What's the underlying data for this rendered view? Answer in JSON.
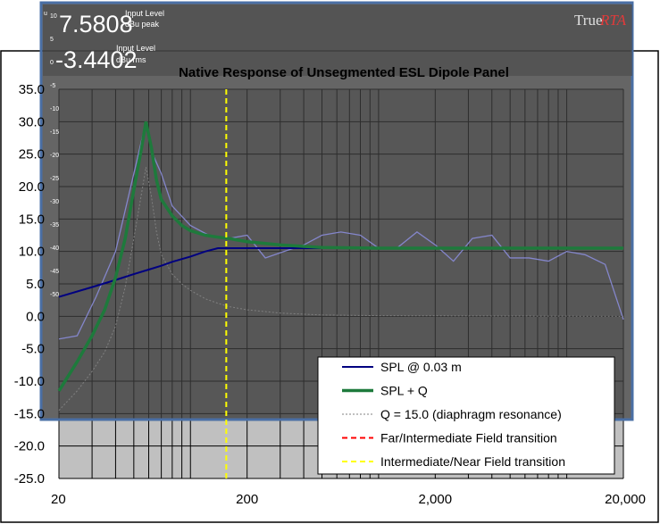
{
  "overlay": {
    "input_level_peak": "7.5808",
    "input_level_peak_label": "Input Level",
    "input_level_peak_unit": "dBu peak",
    "input_level_rms": "-3.4402",
    "input_level_rms_label": "Input Level",
    "input_level_rms_unit": "dBu rms",
    "brand_true": "True",
    "brand_rta": "RTA",
    "left_scale": [
      "10",
      "5",
      "0",
      "-5",
      "-10",
      "-15",
      "-20",
      "-25",
      "-30",
      "-35",
      "-40",
      "-45",
      "-50"
    ],
    "left_scale_unit": "u"
  },
  "chart_data": {
    "type": "line",
    "title": "Native Response of Unsegmented ESL Dipole Panel",
    "x_scale": "log",
    "xlim": [
      20,
      20000
    ],
    "ylim": [
      -25,
      35
    ],
    "x_ticks": [
      20,
      200,
      2000,
      20000
    ],
    "x_tick_labels": [
      "20",
      "200",
      "2,000",
      "20,000"
    ],
    "y_ticks": [
      35,
      30,
      25,
      20,
      15,
      10,
      5,
      0,
      -5,
      -10,
      -15,
      -20,
      -25
    ],
    "y_tick_labels": [
      "35.0",
      "30.0",
      "25.0",
      "20.0",
      "15.0",
      "10.0",
      "5.0",
      "0.0",
      "-5.0",
      "-10.0",
      "-15.0",
      "-20.0",
      "-25.0"
    ],
    "grid": true,
    "legend_position": "bottom-right",
    "vertical_markers": [
      {
        "name": "Intermediate/Near Field transition",
        "x": 155,
        "color": "#ffff00",
        "style": "dashed"
      }
    ],
    "series": [
      {
        "name": "SPL @ 0.03 m",
        "color": "#000080",
        "width": 2,
        "style": "solid",
        "x": [
          20,
          30,
          40,
          50,
          60,
          70,
          80,
          100,
          120,
          140,
          155,
          160,
          200,
          300,
          500,
          1000,
          20000
        ],
        "y": [
          3.0,
          4.5,
          5.6,
          6.5,
          7.2,
          7.8,
          8.4,
          9.2,
          10.0,
          10.5,
          10.5,
          10.5,
          10.5,
          10.5,
          10.5,
          10.5,
          10.5
        ]
      },
      {
        "name": "SPL + Q",
        "color": "#1e7a3c",
        "width": 3.5,
        "style": "solid",
        "x": [
          20,
          25,
          30,
          35,
          40,
          45,
          50,
          55,
          58,
          62,
          66,
          70,
          80,
          90,
          100,
          120,
          140,
          160,
          200,
          300,
          500,
          1000,
          20000
        ],
        "y": [
          -11.5,
          -7.0,
          -3.0,
          1.0,
          6.0,
          12.0,
          19.5,
          26.0,
          30.0,
          26.0,
          21.0,
          18.0,
          15.5,
          14.0,
          13.2,
          12.5,
          12.2,
          12.0,
          11.5,
          11.0,
          10.6,
          10.5,
          10.5
        ]
      },
      {
        "name": "Q = 15.0 (diaphragm resonance)",
        "color": "#808080",
        "width": 1,
        "style": "dotted",
        "x": [
          20,
          25,
          30,
          35,
          40,
          45,
          50,
          55,
          58,
          62,
          66,
          70,
          80,
          90,
          100,
          120,
          140,
          160,
          200,
          300,
          500,
          1000,
          20000
        ],
        "y": [
          -14.5,
          -11.5,
          -8.5,
          -5.5,
          -1.5,
          4.5,
          12.0,
          19.0,
          23.0,
          18.5,
          13.0,
          9.5,
          6.5,
          5.0,
          4.0,
          2.7,
          2.0,
          1.5,
          1.0,
          0.5,
          0.2,
          0.1,
          0.0
        ]
      },
      {
        "name": "Far/Intermediate Field transition",
        "color": "#ff0000",
        "style": "dashed",
        "x": [],
        "y": []
      },
      {
        "name": "Intermediate/Near Field transition",
        "color": "#ffff00",
        "style": "dashed",
        "x": [],
        "y": []
      }
    ],
    "rta_trace": {
      "color": "#8a8cd8",
      "x": [
        20,
        25,
        31.5,
        40,
        50,
        58,
        63,
        70,
        80,
        100,
        125,
        160,
        200,
        250,
        315,
        400,
        500,
        630,
        800,
        1000,
        1250,
        1600,
        2000,
        2500,
        3150,
        4000,
        5000,
        6300,
        8000,
        10000,
        12500,
        16000,
        20000
      ],
      "y": [
        -3.5,
        -3.0,
        3.0,
        10.0,
        22.0,
        30.0,
        25.0,
        22.0,
        17.0,
        14.0,
        12.5,
        12.0,
        12.5,
        9.0,
        10.0,
        11.0,
        12.5,
        13.0,
        12.5,
        10.5,
        10.5,
        13.0,
        11.0,
        8.5,
        12.0,
        12.5,
        9.0,
        9.0,
        8.5,
        10.0,
        9.5,
        8.0,
        -0.5
      ]
    }
  }
}
